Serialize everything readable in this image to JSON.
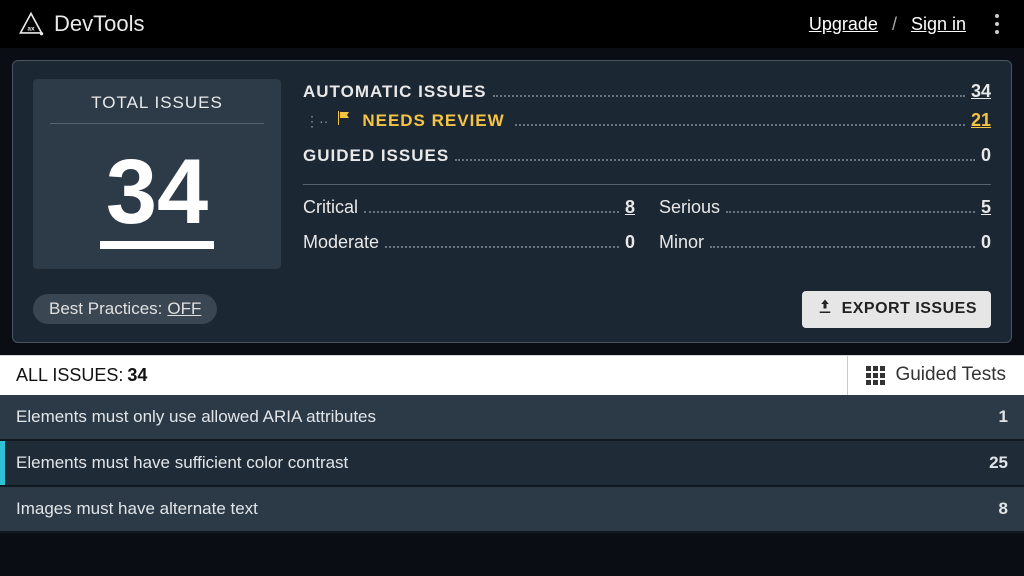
{
  "brand": {
    "name": "DevTools"
  },
  "topbar": {
    "upgrade": "Upgrade",
    "sep": "/",
    "signin": "Sign in"
  },
  "summary": {
    "total_label": "TOTAL ISSUES",
    "total_value": "34",
    "automatic_label": "AUTOMATIC ISSUES",
    "automatic_value": "34",
    "needs_review_label": "NEEDS REVIEW",
    "needs_review_value": "21",
    "guided_label": "GUIDED ISSUES",
    "guided_value": "0",
    "severity": {
      "critical_label": "Critical",
      "critical_value": "8",
      "serious_label": "Serious",
      "serious_value": "5",
      "moderate_label": "Moderate",
      "moderate_value": "0",
      "minor_label": "Minor",
      "minor_value": "0"
    },
    "best_practices_label": "Best Practices:",
    "best_practices_state": "OFF",
    "export_label": "EXPORT ISSUES"
  },
  "tabs": {
    "all_issues_label": "ALL ISSUES:",
    "all_issues_count": "34",
    "guided_tests_label": "Guided Tests"
  },
  "issues": [
    {
      "title": "Elements must only use allowed ARIA attributes",
      "count": "1"
    },
    {
      "title": "Elements must have sufficient color contrast",
      "count": "25"
    },
    {
      "title": "Images must have alternate text",
      "count": "8"
    }
  ],
  "selected_issue_index": 1
}
